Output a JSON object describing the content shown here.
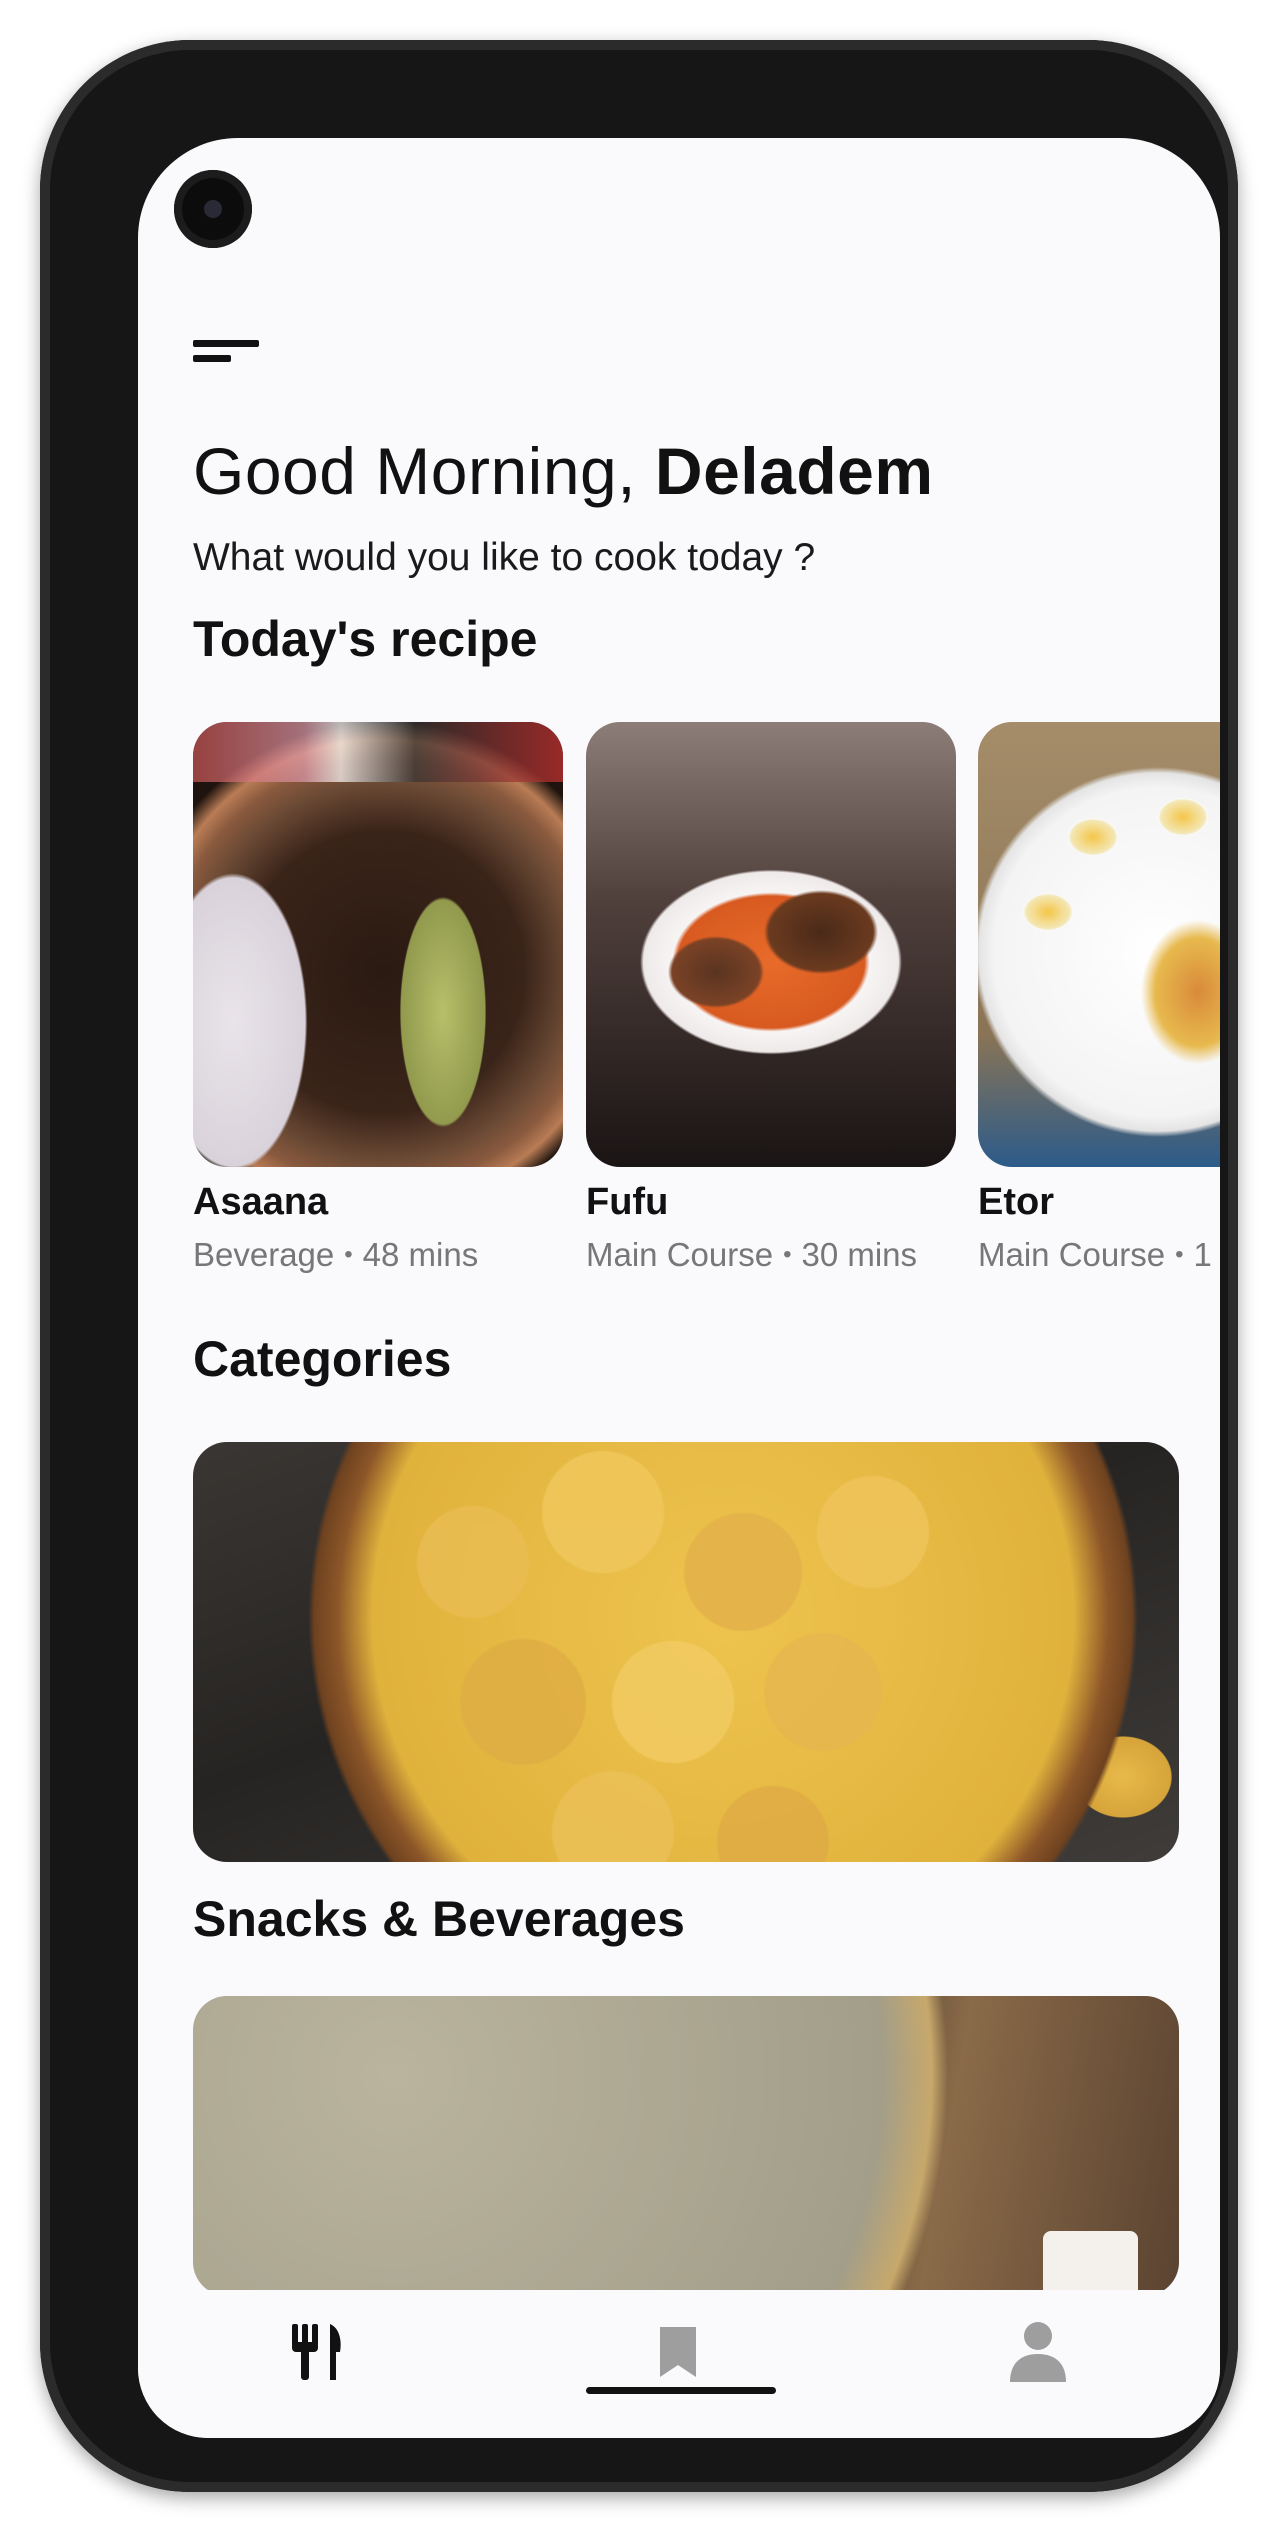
{
  "header": {
    "greeting_prefix": "Good Morning,",
    "user_name": "Deladem",
    "subtitle": "What would you like to cook today ?"
  },
  "today_section": {
    "title": "Today's recipe",
    "recipes": [
      {
        "name": "Asaana",
        "category": "Beverage",
        "duration": "48 mins"
      },
      {
        "name": "Fufu",
        "category": "Main Course",
        "duration": "30 mins"
      },
      {
        "name": "Etor",
        "category": "Main Course",
        "duration": "1"
      }
    ]
  },
  "categories_section": {
    "title": "Categories",
    "items": [
      {
        "label": "Snacks & Beverages"
      }
    ]
  },
  "bottom_nav": {
    "items": [
      {
        "icon": "fork-knife-icon",
        "active": true
      },
      {
        "icon": "bookmark-icon",
        "active": false
      },
      {
        "icon": "user-icon",
        "active": false
      }
    ],
    "active_color": "#111111",
    "inactive_color": "#9e9e9e"
  },
  "colors": {
    "background": "#faf9fc",
    "text_primary": "#111111",
    "text_secondary": "#777777"
  }
}
